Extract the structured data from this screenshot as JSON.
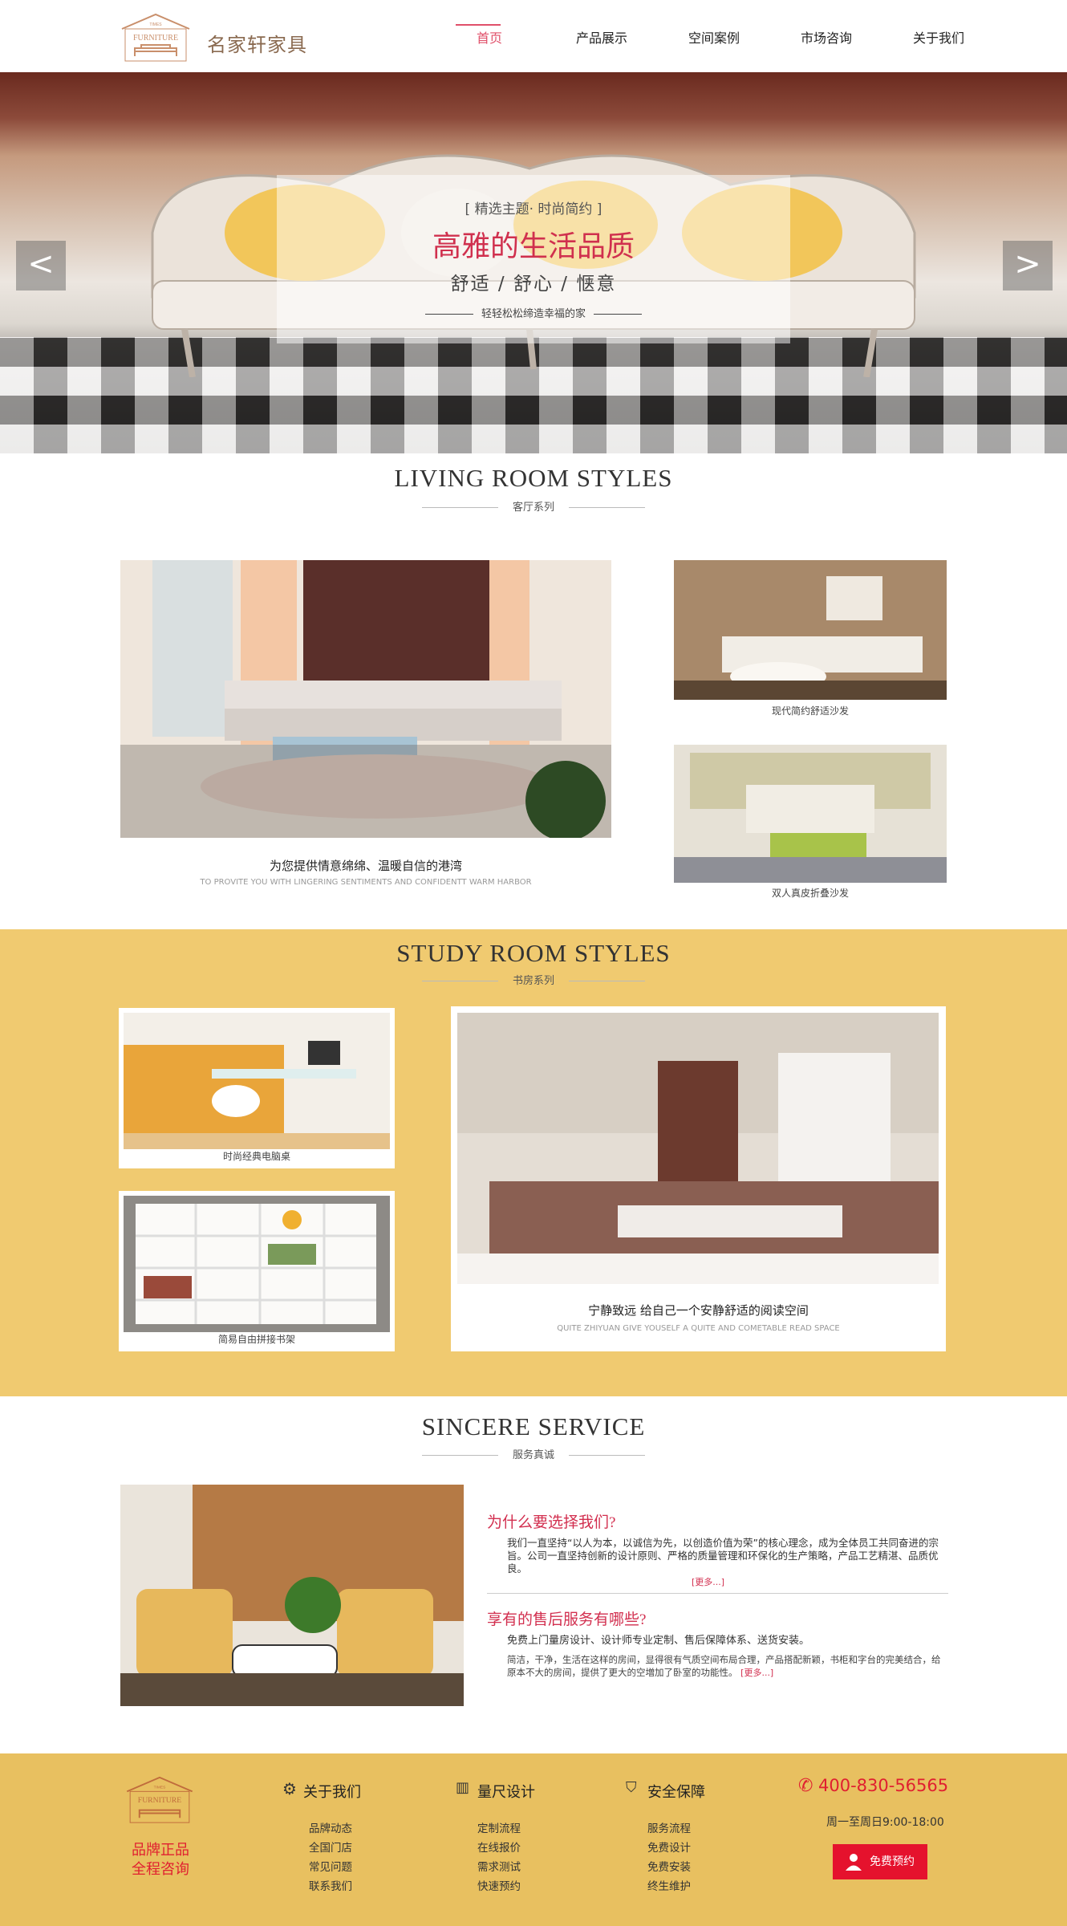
{
  "header": {
    "logo_small": "TIMES",
    "logo_text": "FURNITURE",
    "brand_name": "名家轩家具",
    "nav": [
      "首页",
      "产品展示",
      "空间案例",
      "市场咨询",
      "关于我们"
    ],
    "active_nav": "首页"
  },
  "hero": {
    "tag": "[ 精选主题· 时尚简约 ]",
    "title": "高雅的生活品质",
    "subtitle": "舒适 / 舒心 / 惬意",
    "desc": "轻轻松松缔造幸福的家",
    "prev": "<",
    "next": ">"
  },
  "living": {
    "title": "LIVING ROOM STYLES",
    "subtitle": "客厅系列",
    "main_caption": "为您提供情意绵绵、温暖自信的港湾",
    "main_caption_en": "TO PROVITE YOU WITH LINGERING SENTIMENTS AND CONFIDENTT WARM HARBOR",
    "item1": "现代简约舒适沙发",
    "item2": "双人真皮折叠沙发"
  },
  "study": {
    "title": "STUDY ROOM STYLES",
    "subtitle": "书房系列",
    "item1": "时尚经典电脑桌",
    "item2": "简易自由拼接书架",
    "main_caption": "宁静致远  给自己一个安静舒适的阅读空间",
    "main_caption_en": "QUITE ZHIYUAN GIVE YOUSELF A QUITE AND COMETABLE READ SPACE"
  },
  "service": {
    "title": "SINCERE SERVICE",
    "subtitle": "服务真诚",
    "q1": "为什么要选择我们?",
    "a1": "我们一直坚持“以人为本，以诚信为先，以创造价值为荣”的核心理念，成为全体员工共同奋进的宗旨。公司一直坚持创新的设计原则、严格的质量管理和环保化的生产策略，产品工艺精湛、品质优良。",
    "more1": "[更多...]",
    "q2": "享有的售后服务有哪些?",
    "a2_lead": "免费上门量房设计、设计师专业定制、售后保障体系、送货安装。",
    "a2": "简洁，干净，生活在这样的房间，显得很有气质空间布局合理，产品搭配新颖，书柜和字台的完美结合，给原本不大的房间，提供了更大的空増加了卧室的功能性。",
    "more2": "[更多...]"
  },
  "footer": {
    "logo_small": "TIMES",
    "logo_text": "FURNITURE",
    "slogan1": "品牌正品",
    "slogan2": "全程咨询",
    "col1_title": "关于我们",
    "col1": [
      "品牌动态",
      "全国门店",
      "常见问题",
      "联系我们"
    ],
    "col2_title": "量尺设计",
    "col2": [
      "定制流程",
      "在线报价",
      "需求测试",
      "快速预约"
    ],
    "col3_title": "安全保障",
    "col3": [
      "服务流程",
      "免费设计",
      "免费安装",
      "终生维护"
    ],
    "phone": "400-830-56565",
    "hours": "周一至周日9:00-18:00",
    "book": "免费预约"
  },
  "colors": {
    "accent": "#d22f4f",
    "band": "#f0ca70",
    "footer": "#e8c060",
    "brand": "#8a6a50"
  }
}
